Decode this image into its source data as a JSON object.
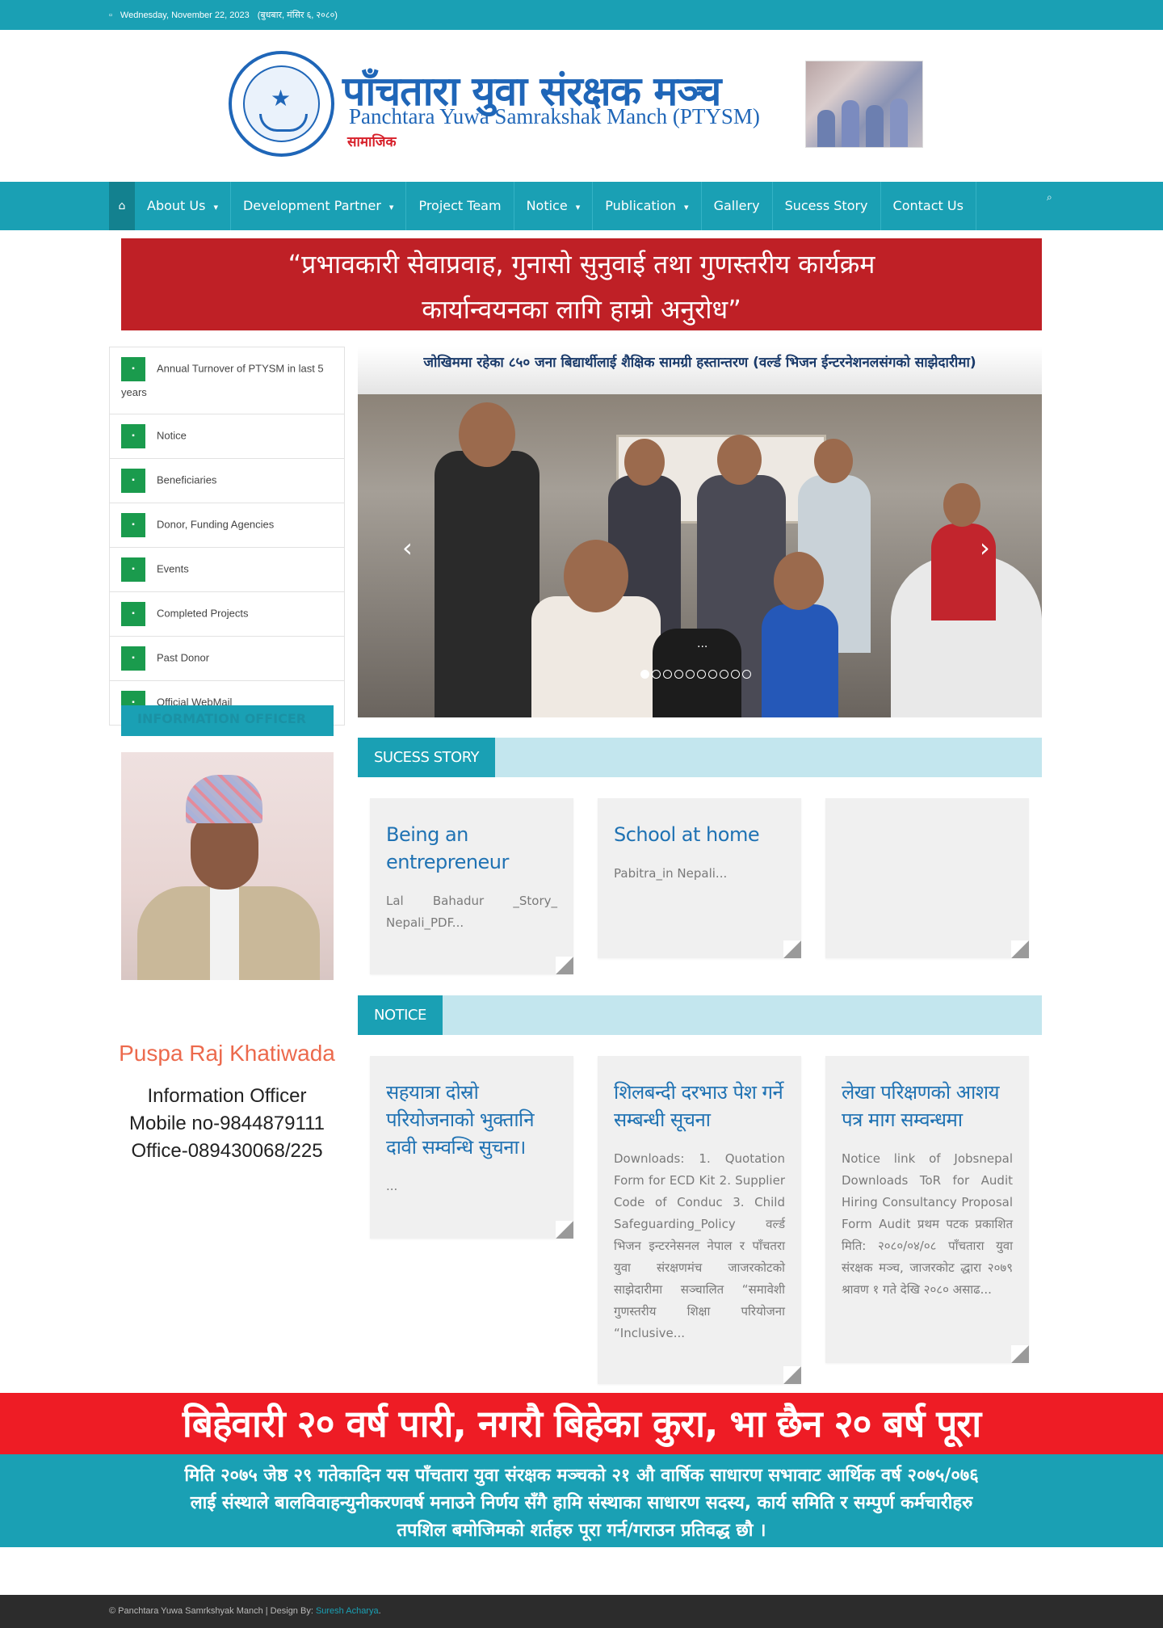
{
  "topbar": {
    "date": "Wednesday, November 22, 2023",
    "nepali_date": "(बुधबार, मंसिर ६, २०८०)",
    "calendar_icon": "calendar-icon"
  },
  "header": {
    "org_name_np": "पाँचतारा युवा संरक्षक मञ्च",
    "org_name_en": "Panchtara Yuwa Samrakshak Manch (PTYSM)",
    "tagline": "सामाजिक"
  },
  "nav": {
    "home_icon": "home-icon",
    "items": [
      {
        "label": "About Us",
        "dropdown": true
      },
      {
        "label": "Development Partner",
        "dropdown": true
      },
      {
        "label": "Project Team",
        "dropdown": false
      },
      {
        "label": "Notice",
        "dropdown": true
      },
      {
        "label": "Publication",
        "dropdown": true
      },
      {
        "label": "Gallery",
        "dropdown": false
      },
      {
        "label": "Sucess Story",
        "dropdown": false
      },
      {
        "label": "Contact Us",
        "dropdown": false
      }
    ],
    "search_icon": "search-icon"
  },
  "banner": {
    "line1": "“प्रभावकारी सेवाप्रवाह, गुनासो सुनुवाई तथा गुणस्तरीय कार्यक्रम",
    "line2": "कार्यान्वयनका लागि हाम्रो अनुरोध”",
    "bg_color": "#bf2026"
  },
  "sidebar": {
    "items": [
      {
        "label": "Annual Turnover of PTYSM in last 5 years"
      },
      {
        "label": "Notice"
      },
      {
        "label": "Beneficiaries"
      },
      {
        "label": "Donor, Funding Agencies"
      },
      {
        "label": "Events"
      },
      {
        "label": "Completed Projects"
      },
      {
        "label": "Past Donor"
      },
      {
        "label": "Official WebMail"
      }
    ],
    "info_officer_title": "INFORMATION OFFICER",
    "officer": {
      "name": "Puspa Raj Khatiwada",
      "role": "Information Officer",
      "mobile": "Mobile no-9844879111",
      "office": "Office-089430068/225"
    }
  },
  "slider": {
    "caption": "जोखिममा रहेका ८५० जना बिद्यार्थीलाई शैक्षिक सामग्री हस्तान्तरण (वर्ल्ड भिजन ईन्टरनेशनलसंगको साझेदारीमा)",
    "prev_icon": "chevron-left-icon",
    "next_icon": "chevron-right-icon",
    "slide_ellipsis": "...",
    "slide_count": 10,
    "active_slide": 1
  },
  "success_story": {
    "heading": "SUCESS STORY",
    "cards": [
      {
        "title": "Being an entrepreneur",
        "excerpt": "Lal Bahadur _Story_ Nepali_PDF..."
      },
      {
        "title": "School at home",
        "excerpt": "Pabitra_in Nepali..."
      },
      {
        "title": "",
        "excerpt": ""
      }
    ]
  },
  "notice": {
    "heading": "NOTICE",
    "cards": [
      {
        "title": "सहयात्रा दोस्रो परियोजनाको भुक्तानि दावी सम्वन्धि सुचना।",
        "excerpt": "..."
      },
      {
        "title": "शिलबन्दी दरभाउ पेश गर्ने सम्बन्धी सूचना",
        "excerpt": "Downloads: 1. Quotation Form for ECD Kit 2. Supplier Code of Conduc 3. Child Safeguarding_Policy वर्ल्ड भिजन इन्टरनेसनल नेपाल र पाँचतरा युवा संरक्षणमंच जाजरकोटको साझेदारीमा सञ्चालित “समावेशी गुणस्तरीय शिक्षा परियोजना “Inclusive..."
      },
      {
        "title": "लेखा परिक्षणको आशय पत्र माग सम्वन्धमा",
        "excerpt": "Notice link of Jobsnepal Downloads ToR for Audit Hiring Consultancy Proposal Form Audit प्रथम पटक प्रकाशित मिति: २०८०/०४/०८ पाँचतारा युवा संरक्षक मञ्च, जाजरकोट द्धारा २०७९ श्रावण १ गते देखि २०८० असाढ..."
      }
    ]
  },
  "campaign": {
    "headline": "बिहेवारी २० वर्ष पारी, नगरौ बिहेका कुरा, भा छैन २० बर्ष पूरा",
    "body_line1": "मिति २०७५ जेष्ठ २९ गतेकादिन यस पाँचतारा युवा संरक्षक मञ्चको २१ औ वार्षिक साधारण सभावाट आर्थिक वर्ष २०७५/०७६",
    "body_line2": "लाई संस्थाले बालविवाहन्युनीकरणवर्ष मनाउने निर्णय सँगै हामि संस्थाका साधारण सदस्य, कार्य समिति र सम्पुर्ण कर्मचारीहरु",
    "body_line3": "तपशिल बमोजिमको शर्तहरु पूरा गर्न/गराउन प्रतिवद्ध छौ ।",
    "red": "#ee1c25",
    "teal": "#1aa0b4"
  },
  "footer": {
    "copyright": "© Panchtara Yuwa Samrkshyak Manch | Design By: ",
    "designer": "Suresh Acharya",
    "suffix": "."
  },
  "colors": {
    "accent": "#1aa0b4",
    "sidebar_icon": "#1a9b4d",
    "link_blue": "#1f72b3"
  }
}
